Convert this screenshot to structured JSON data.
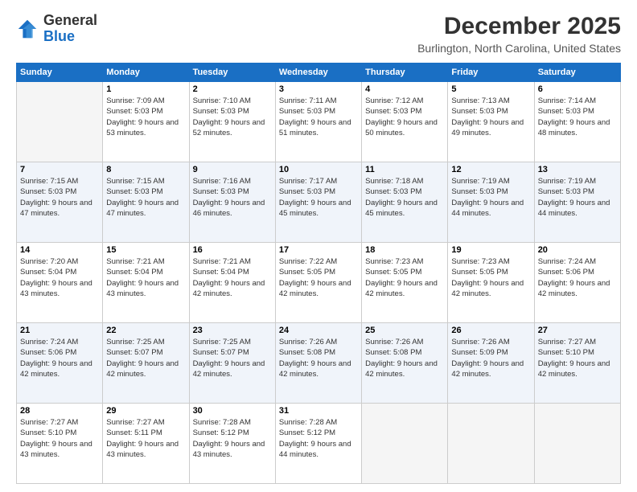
{
  "header": {
    "logo": {
      "line1": "General",
      "line2": "Blue"
    },
    "month": "December 2025",
    "location": "Burlington, North Carolina, United States"
  },
  "weekdays": [
    "Sunday",
    "Monday",
    "Tuesday",
    "Wednesday",
    "Thursday",
    "Friday",
    "Saturday"
  ],
  "weeks": [
    [
      {
        "day": "",
        "empty": true
      },
      {
        "day": "1",
        "sunrise": "Sunrise: 7:09 AM",
        "sunset": "Sunset: 5:03 PM",
        "daylight": "Daylight: 9 hours and 53 minutes."
      },
      {
        "day": "2",
        "sunrise": "Sunrise: 7:10 AM",
        "sunset": "Sunset: 5:03 PM",
        "daylight": "Daylight: 9 hours and 52 minutes."
      },
      {
        "day": "3",
        "sunrise": "Sunrise: 7:11 AM",
        "sunset": "Sunset: 5:03 PM",
        "daylight": "Daylight: 9 hours and 51 minutes."
      },
      {
        "day": "4",
        "sunrise": "Sunrise: 7:12 AM",
        "sunset": "Sunset: 5:03 PM",
        "daylight": "Daylight: 9 hours and 50 minutes."
      },
      {
        "day": "5",
        "sunrise": "Sunrise: 7:13 AM",
        "sunset": "Sunset: 5:03 PM",
        "daylight": "Daylight: 9 hours and 49 minutes."
      },
      {
        "day": "6",
        "sunrise": "Sunrise: 7:14 AM",
        "sunset": "Sunset: 5:03 PM",
        "daylight": "Daylight: 9 hours and 48 minutes."
      }
    ],
    [
      {
        "day": "7",
        "sunrise": "Sunrise: 7:15 AM",
        "sunset": "Sunset: 5:03 PM",
        "daylight": "Daylight: 9 hours and 47 minutes."
      },
      {
        "day": "8",
        "sunrise": "Sunrise: 7:15 AM",
        "sunset": "Sunset: 5:03 PM",
        "daylight": "Daylight: 9 hours and 47 minutes."
      },
      {
        "day": "9",
        "sunrise": "Sunrise: 7:16 AM",
        "sunset": "Sunset: 5:03 PM",
        "daylight": "Daylight: 9 hours and 46 minutes."
      },
      {
        "day": "10",
        "sunrise": "Sunrise: 7:17 AM",
        "sunset": "Sunset: 5:03 PM",
        "daylight": "Daylight: 9 hours and 45 minutes."
      },
      {
        "day": "11",
        "sunrise": "Sunrise: 7:18 AM",
        "sunset": "Sunset: 5:03 PM",
        "daylight": "Daylight: 9 hours and 45 minutes."
      },
      {
        "day": "12",
        "sunrise": "Sunrise: 7:19 AM",
        "sunset": "Sunset: 5:03 PM",
        "daylight": "Daylight: 9 hours and 44 minutes."
      },
      {
        "day": "13",
        "sunrise": "Sunrise: 7:19 AM",
        "sunset": "Sunset: 5:03 PM",
        "daylight": "Daylight: 9 hours and 44 minutes."
      }
    ],
    [
      {
        "day": "14",
        "sunrise": "Sunrise: 7:20 AM",
        "sunset": "Sunset: 5:04 PM",
        "daylight": "Daylight: 9 hours and 43 minutes."
      },
      {
        "day": "15",
        "sunrise": "Sunrise: 7:21 AM",
        "sunset": "Sunset: 5:04 PM",
        "daylight": "Daylight: 9 hours and 43 minutes."
      },
      {
        "day": "16",
        "sunrise": "Sunrise: 7:21 AM",
        "sunset": "Sunset: 5:04 PM",
        "daylight": "Daylight: 9 hours and 42 minutes."
      },
      {
        "day": "17",
        "sunrise": "Sunrise: 7:22 AM",
        "sunset": "Sunset: 5:05 PM",
        "daylight": "Daylight: 9 hours and 42 minutes."
      },
      {
        "day": "18",
        "sunrise": "Sunrise: 7:23 AM",
        "sunset": "Sunset: 5:05 PM",
        "daylight": "Daylight: 9 hours and 42 minutes."
      },
      {
        "day": "19",
        "sunrise": "Sunrise: 7:23 AM",
        "sunset": "Sunset: 5:05 PM",
        "daylight": "Daylight: 9 hours and 42 minutes."
      },
      {
        "day": "20",
        "sunrise": "Sunrise: 7:24 AM",
        "sunset": "Sunset: 5:06 PM",
        "daylight": "Daylight: 9 hours and 42 minutes."
      }
    ],
    [
      {
        "day": "21",
        "sunrise": "Sunrise: 7:24 AM",
        "sunset": "Sunset: 5:06 PM",
        "daylight": "Daylight: 9 hours and 42 minutes."
      },
      {
        "day": "22",
        "sunrise": "Sunrise: 7:25 AM",
        "sunset": "Sunset: 5:07 PM",
        "daylight": "Daylight: 9 hours and 42 minutes."
      },
      {
        "day": "23",
        "sunrise": "Sunrise: 7:25 AM",
        "sunset": "Sunset: 5:07 PM",
        "daylight": "Daylight: 9 hours and 42 minutes."
      },
      {
        "day": "24",
        "sunrise": "Sunrise: 7:26 AM",
        "sunset": "Sunset: 5:08 PM",
        "daylight": "Daylight: 9 hours and 42 minutes."
      },
      {
        "day": "25",
        "sunrise": "Sunrise: 7:26 AM",
        "sunset": "Sunset: 5:08 PM",
        "daylight": "Daylight: 9 hours and 42 minutes."
      },
      {
        "day": "26",
        "sunrise": "Sunrise: 7:26 AM",
        "sunset": "Sunset: 5:09 PM",
        "daylight": "Daylight: 9 hours and 42 minutes."
      },
      {
        "day": "27",
        "sunrise": "Sunrise: 7:27 AM",
        "sunset": "Sunset: 5:10 PM",
        "daylight": "Daylight: 9 hours and 42 minutes."
      }
    ],
    [
      {
        "day": "28",
        "sunrise": "Sunrise: 7:27 AM",
        "sunset": "Sunset: 5:10 PM",
        "daylight": "Daylight: 9 hours and 43 minutes."
      },
      {
        "day": "29",
        "sunrise": "Sunrise: 7:27 AM",
        "sunset": "Sunset: 5:11 PM",
        "daylight": "Daylight: 9 hours and 43 minutes."
      },
      {
        "day": "30",
        "sunrise": "Sunrise: 7:28 AM",
        "sunset": "Sunset: 5:12 PM",
        "daylight": "Daylight: 9 hours and 43 minutes."
      },
      {
        "day": "31",
        "sunrise": "Sunrise: 7:28 AM",
        "sunset": "Sunset: 5:12 PM",
        "daylight": "Daylight: 9 hours and 44 minutes."
      },
      {
        "day": "",
        "empty": true
      },
      {
        "day": "",
        "empty": true
      },
      {
        "day": "",
        "empty": true
      }
    ]
  ]
}
